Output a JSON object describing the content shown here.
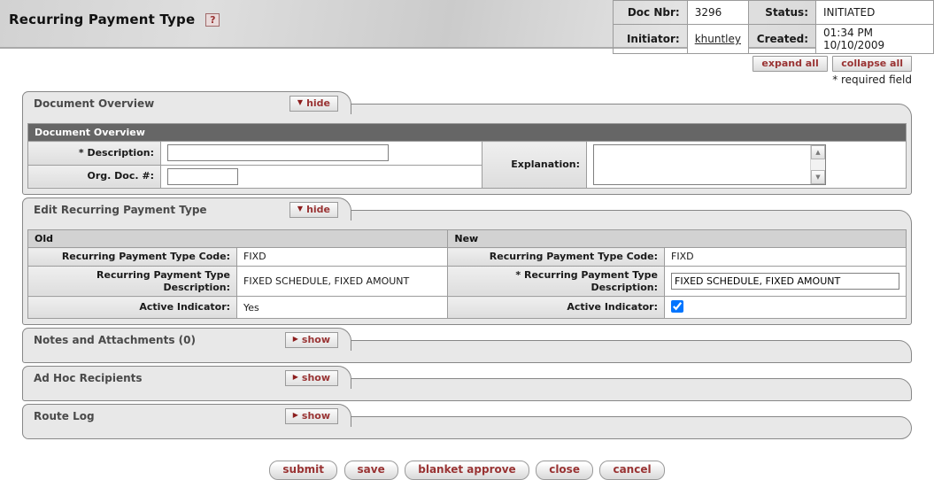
{
  "page": {
    "title": "Recurring Payment Type"
  },
  "icons": {
    "help": "?",
    "triangle_down": "▼",
    "triangle_right": "▶",
    "scroll_up": "▲",
    "scroll_down": "▼"
  },
  "doc_header": {
    "doc_nbr_label": "Doc Nbr:",
    "doc_nbr": "3296",
    "status_label": "Status:",
    "status": "INITIATED",
    "initiator_label": "Initiator:",
    "initiator": "khuntley",
    "created_label": "Created:",
    "created": "01:34 PM 10/10/2009"
  },
  "controls": {
    "expand_all": "expand all",
    "collapse_all": "collapse all",
    "required_note": "* required field"
  },
  "document_overview": {
    "tab_title": "Document Overview",
    "hide_label": "hide",
    "inner_header": "Document Overview",
    "description_label": "* Description:",
    "description_value": "",
    "org_doc_label": "Org. Doc. #:",
    "org_doc_value": "",
    "explanation_label": "Explanation:",
    "explanation_value": ""
  },
  "edit_section": {
    "tab_title": "Edit Recurring Payment Type",
    "hide_label": "hide",
    "old_header": "Old",
    "new_header": "New",
    "old": {
      "code_label": "Recurring Payment Type Code:",
      "code_value": "FIXD",
      "desc_label": "Recurring Payment Type Description:",
      "desc_value": "FIXED SCHEDULE, FIXED AMOUNT",
      "active_label": "Active Indicator:",
      "active_value": "Yes"
    },
    "new": {
      "code_label": "Recurring Payment Type Code:",
      "code_value": "FIXD",
      "desc_label": "* Recurring Payment Type Description:",
      "desc_value": "FIXED SCHEDULE, FIXED AMOUNT",
      "active_label": "Active Indicator:",
      "active_checked": true
    }
  },
  "collapsed_sections": [
    {
      "title": "Notes and Attachments (0)",
      "show_label": "show"
    },
    {
      "title": "Ad Hoc Recipients",
      "show_label": "show"
    },
    {
      "title": "Route Log",
      "show_label": "show"
    }
  ],
  "footer_buttons": [
    "submit",
    "save",
    "blanket approve",
    "close",
    "cancel"
  ]
}
